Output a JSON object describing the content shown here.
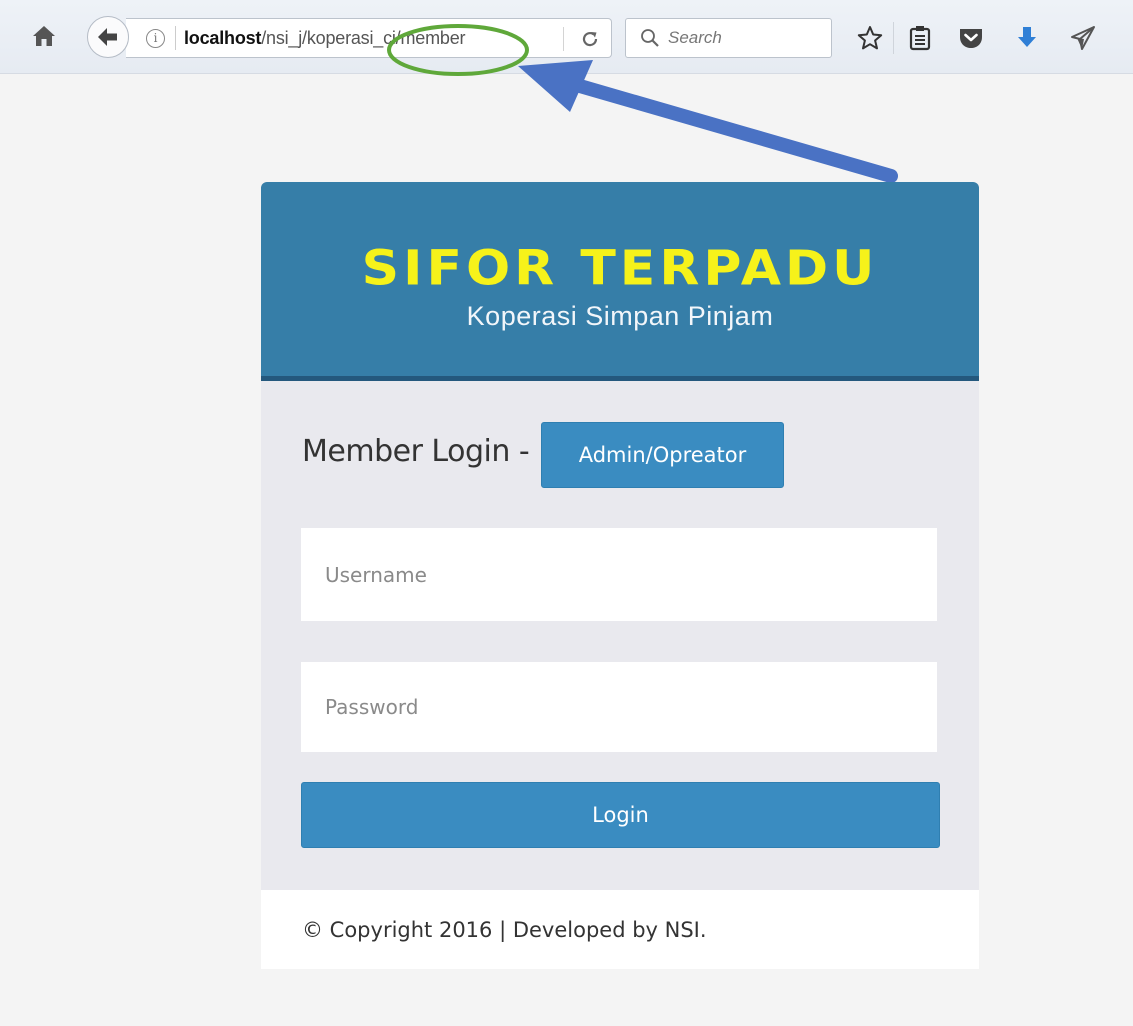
{
  "browser": {
    "home_icon": "home-icon",
    "back_icon": "back-arrow-icon",
    "url": {
      "host": "localhost",
      "path": "/nsi_j/koperasi_ci/member"
    },
    "reload_icon": "reload-icon",
    "search": {
      "placeholder": "Search"
    },
    "toolbar_icons": [
      "bookmark-star-icon",
      "reading-list-icon",
      "pocket-icon",
      "downloads-icon",
      "share-icon"
    ]
  },
  "annotation": {
    "ellipse_color": "#5fa83a",
    "arrow_color": "#4a72c4"
  },
  "login_card": {
    "logo": {
      "title": "SIFOR TERPADU",
      "subtitle": "Koperasi Simpan Pinjam"
    },
    "heading": "Member Login -",
    "switch_button": "Admin/Opreator",
    "username_placeholder": "Username",
    "password_placeholder": "Password",
    "login_button": "Login",
    "footer": "© Copyright 2016 | Developed by NSI."
  },
  "colors": {
    "header_bg": "#367ea8",
    "logo_title": "#f6f21a",
    "button_bg": "#3a8cc1",
    "body_bg": "#e9e9ee"
  }
}
